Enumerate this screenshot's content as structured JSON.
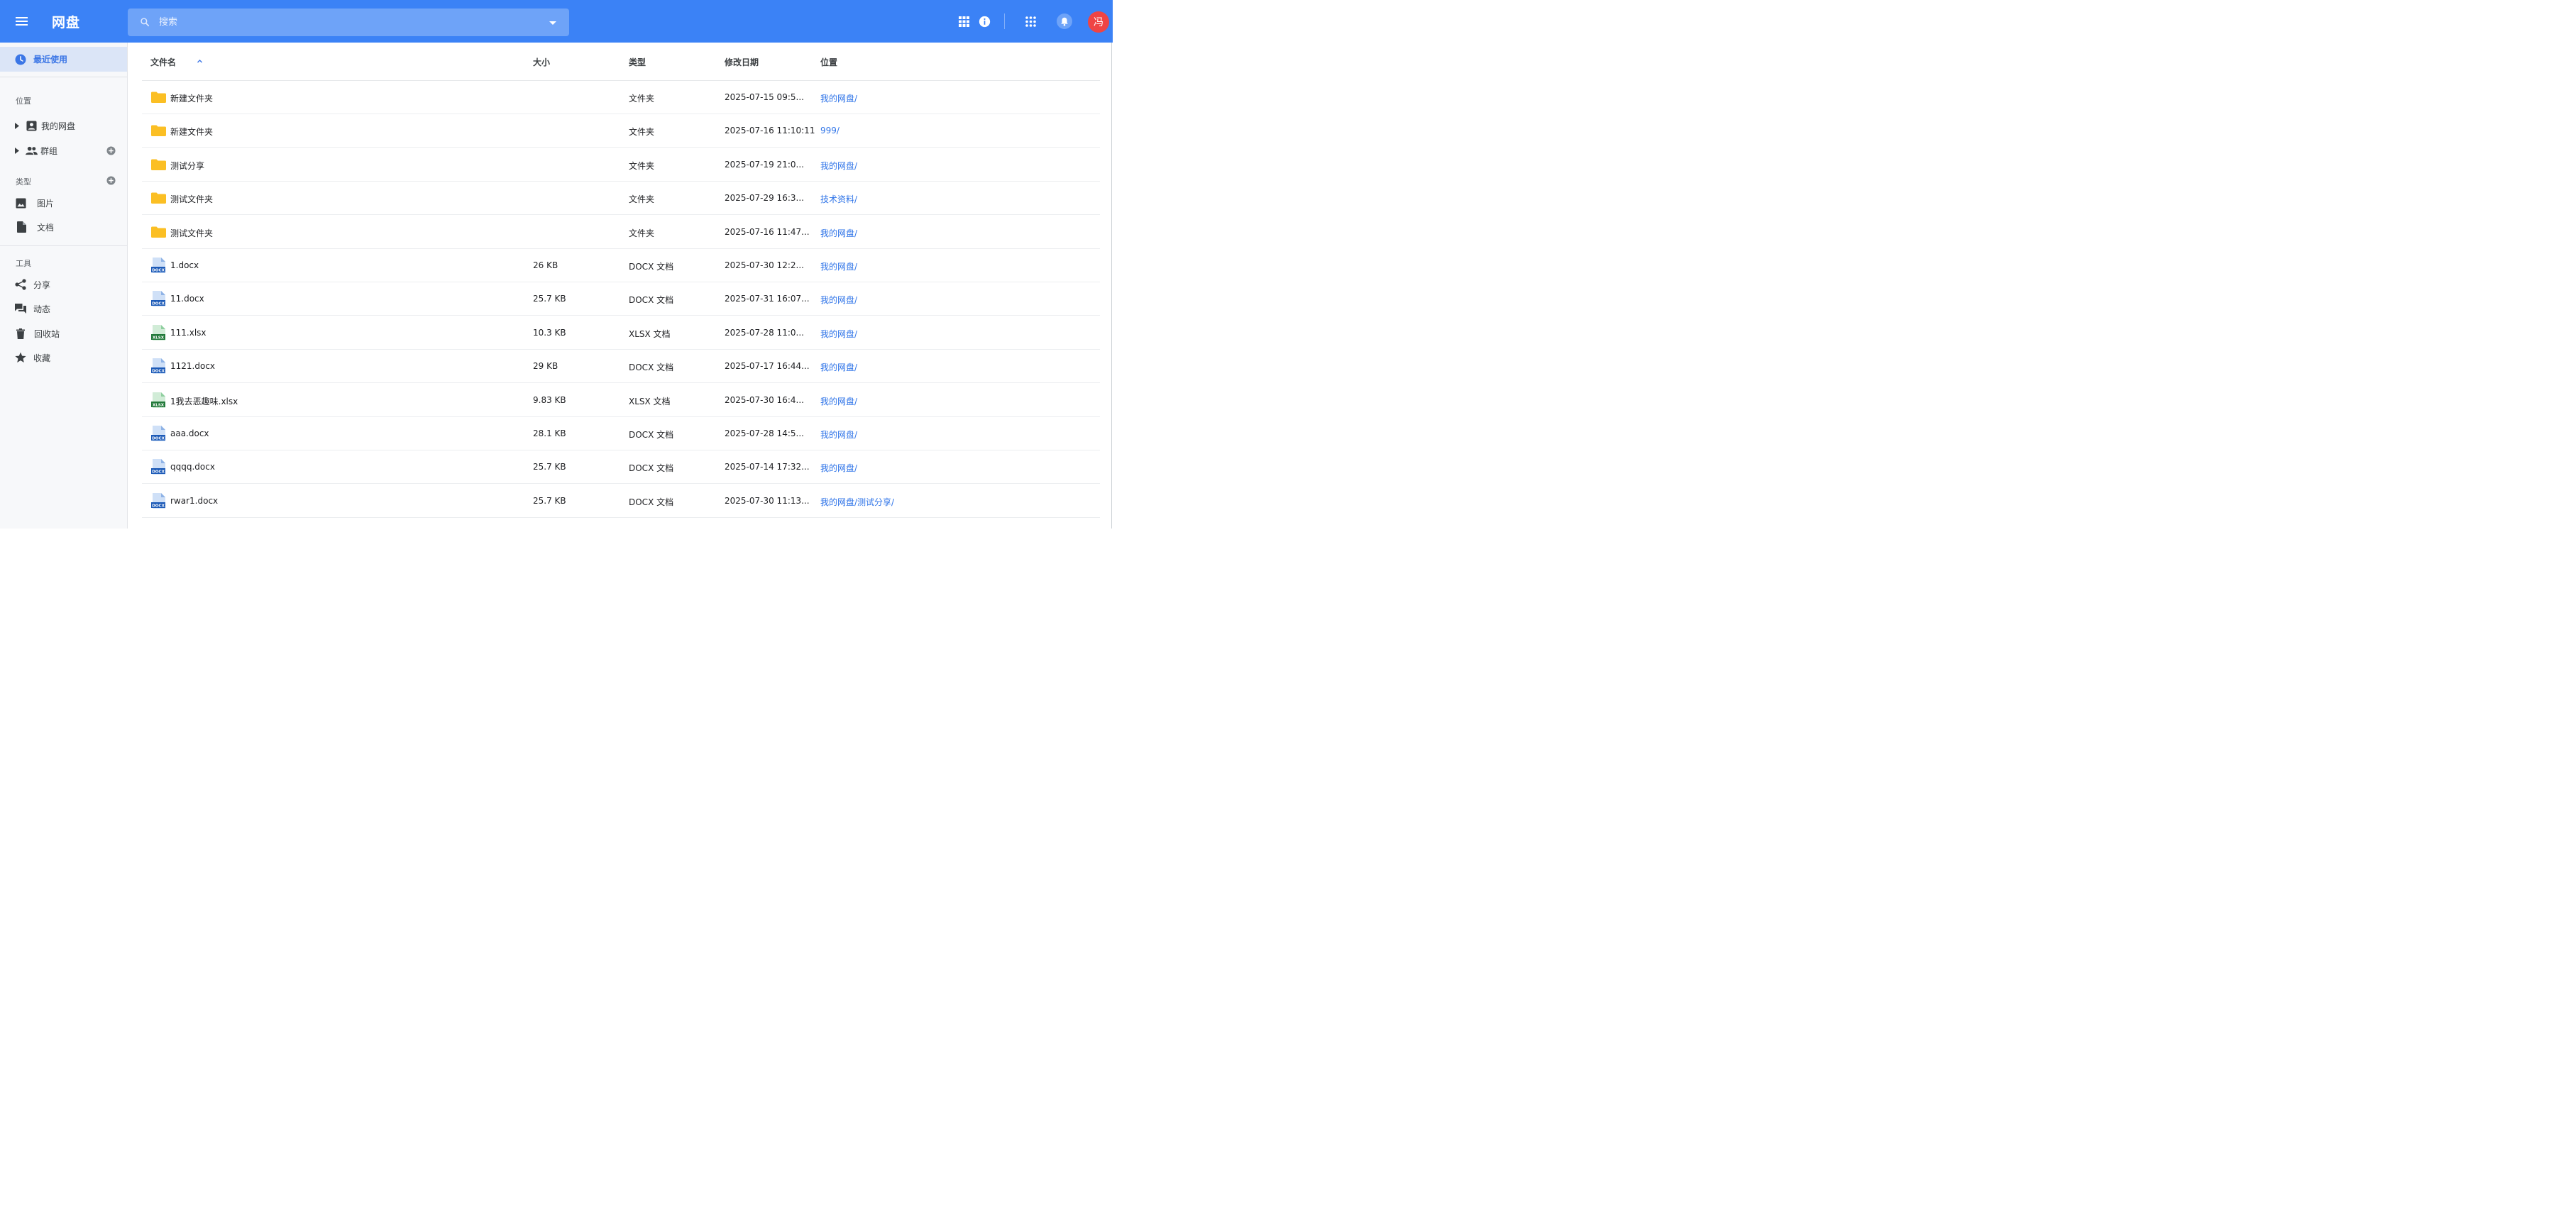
{
  "app": {
    "title": "网盘"
  },
  "search": {
    "placeholder": "搜索"
  },
  "user": {
    "avatar_text": "冯"
  },
  "colors": {
    "topbar": "#3b82f6",
    "accent": "#2f74e8",
    "folder": "#fbbf24",
    "docx": "#1d5bb8",
    "xlsx": "#237a3b",
    "avatar": "#ef4444"
  },
  "toolbar": {
    "icons": [
      "view-grid-icon",
      "info-icon",
      "apps-icon",
      "bell-icon"
    ]
  },
  "sidebar": {
    "recent": {
      "label": "最近使用",
      "icon": "clock-icon"
    },
    "location_title": "位置",
    "locations": [
      {
        "label": "我的网盘",
        "icon": "account-box-icon"
      },
      {
        "label": "群组",
        "icon": "group-icon"
      }
    ],
    "type_title": "类型",
    "types": [
      {
        "label": "图片",
        "icon": "image-icon"
      },
      {
        "label": "文档",
        "icon": "document-icon"
      }
    ],
    "tools_title": "工具",
    "tools": [
      {
        "label": "分享",
        "icon": "share-icon"
      },
      {
        "label": "动态",
        "icon": "forum-icon"
      },
      {
        "label": "回收站",
        "icon": "trash-icon"
      },
      {
        "label": "收藏",
        "icon": "star-icon"
      }
    ]
  },
  "table": {
    "columns": {
      "name": "文件名",
      "size": "大小",
      "type": "类型",
      "modified": "修改日期",
      "location": "位置"
    },
    "rows": [
      {
        "kind": "folder",
        "name": "新建文件夹",
        "size": "",
        "type": "文件夹",
        "modified": "2025-07-15 09:5...",
        "location": "我的网盘/"
      },
      {
        "kind": "folder",
        "name": "新建文件夹",
        "size": "",
        "type": "文件夹",
        "modified": "2025-07-16 11:10:11",
        "location": "999/"
      },
      {
        "kind": "folder",
        "name": "测试分享",
        "size": "",
        "type": "文件夹",
        "modified": "2025-07-19 21:0...",
        "location": "我的网盘/"
      },
      {
        "kind": "folder",
        "name": "测试文件夹",
        "size": "",
        "type": "文件夹",
        "modified": "2025-07-29 16:3...",
        "location": "技术资料/"
      },
      {
        "kind": "folder",
        "name": "测试文件夹",
        "size": "",
        "type": "文件夹",
        "modified": "2025-07-16 11:47...",
        "location": "我的网盘/"
      },
      {
        "kind": "docx",
        "name": "1.docx",
        "size": "26 KB",
        "type": "DOCX 文档",
        "modified": "2025-07-30 12:2...",
        "location": "我的网盘/"
      },
      {
        "kind": "docx",
        "name": "11.docx",
        "size": "25.7 KB",
        "type": "DOCX 文档",
        "modified": "2025-07-31 16:07...",
        "location": "我的网盘/"
      },
      {
        "kind": "xlsx",
        "name": "111.xlsx",
        "size": "10.3 KB",
        "type": "XLSX 文档",
        "modified": "2025-07-28 11:0...",
        "location": "我的网盘/"
      },
      {
        "kind": "docx",
        "name": "1121.docx",
        "size": "29 KB",
        "type": "DOCX 文档",
        "modified": "2025-07-17 16:44...",
        "location": "我的网盘/"
      },
      {
        "kind": "xlsx",
        "name": "1我去恶趣味.xlsx",
        "size": "9.83 KB",
        "type": "XLSX 文档",
        "modified": "2025-07-30 16:4...",
        "location": "我的网盘/"
      },
      {
        "kind": "docx",
        "name": "aaa.docx",
        "size": "28.1 KB",
        "type": "DOCX 文档",
        "modified": "2025-07-28 14:5...",
        "location": "我的网盘/"
      },
      {
        "kind": "docx",
        "name": "qqqq.docx",
        "size": "25.7 KB",
        "type": "DOCX 文档",
        "modified": "2025-07-14 17:32...",
        "location": "我的网盘/"
      },
      {
        "kind": "docx",
        "name": "rwar1.docx",
        "size": "25.7 KB",
        "type": "DOCX 文档",
        "modified": "2025-07-30 11:13...",
        "location": "我的网盘/测试分享/"
      }
    ]
  },
  "file_badges": {
    "docx": "DOCX",
    "xlsx": "XLSX"
  }
}
